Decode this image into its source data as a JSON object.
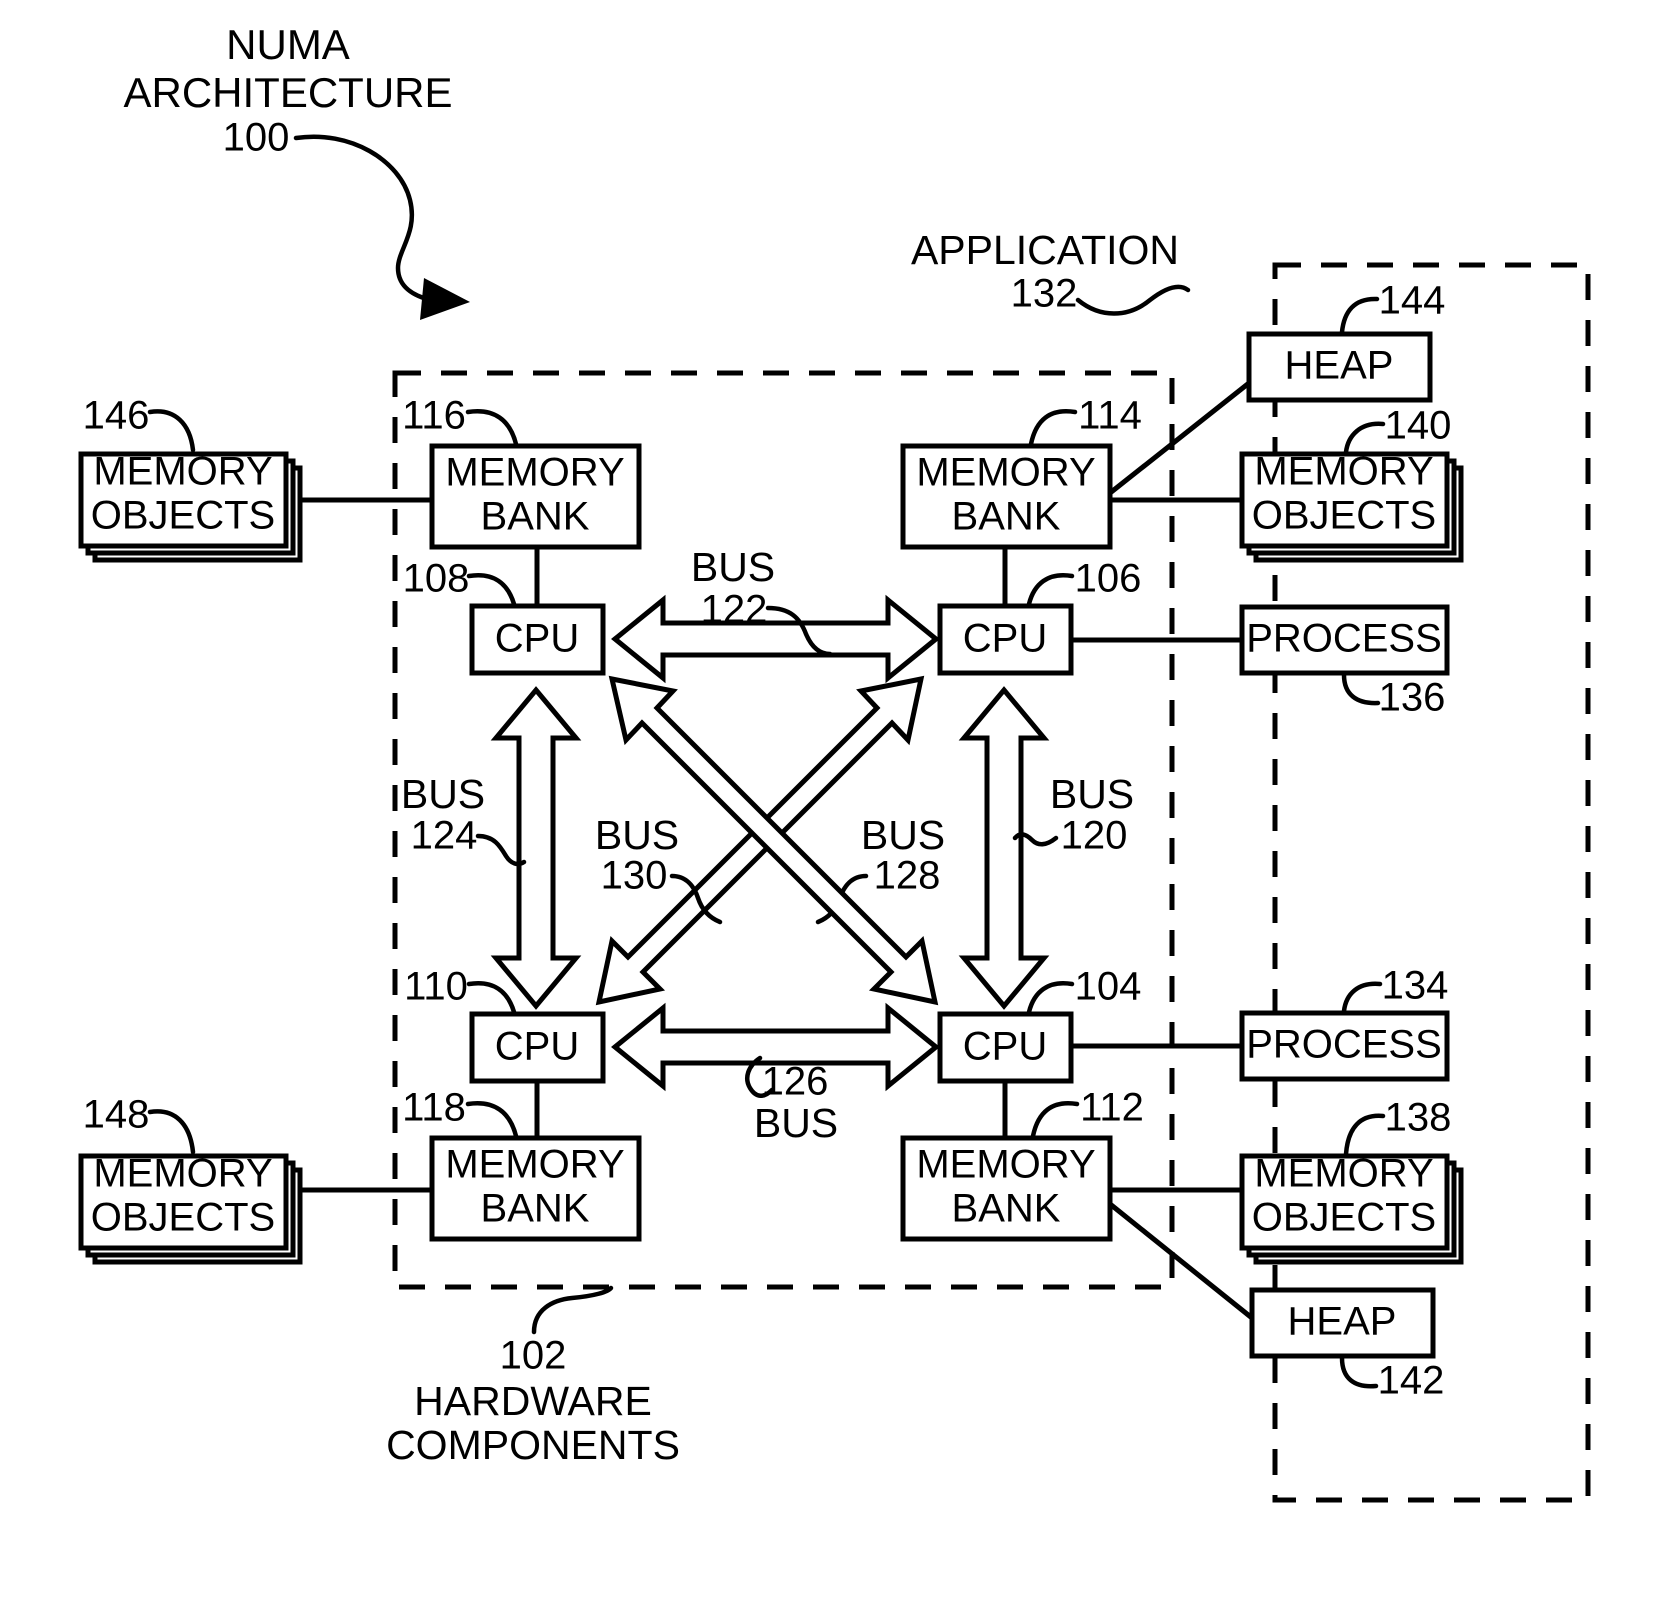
{
  "figure": {
    "title_lines": [
      "NUMA",
      "ARCHITECTURE"
    ],
    "title_ref": "100"
  },
  "regions": {
    "hardware": {
      "ref": "102",
      "label_lines": [
        "HARDWARE",
        "COMPONENTS"
      ],
      "style": "dashed-boundary"
    },
    "application": {
      "ref": "132",
      "label": "APPLICATION",
      "style": "dashed-boundary"
    }
  },
  "nodes": {
    "memory_bank_116": {
      "label_lines": [
        "MEMORY",
        "BANK"
      ],
      "ref": "116"
    },
    "memory_bank_114": {
      "label_lines": [
        "MEMORY",
        "BANK"
      ],
      "ref": "114"
    },
    "memory_bank_118": {
      "label_lines": [
        "MEMORY",
        "BANK"
      ],
      "ref": "118"
    },
    "memory_bank_112": {
      "label_lines": [
        "MEMORY",
        "BANK"
      ],
      "ref": "112"
    },
    "cpu_108": {
      "label": "CPU",
      "ref": "108"
    },
    "cpu_106": {
      "label": "CPU",
      "ref": "106"
    },
    "cpu_110": {
      "label": "CPU",
      "ref": "110"
    },
    "cpu_104": {
      "label": "CPU",
      "ref": "104"
    },
    "memory_objects_146": {
      "label_lines": [
        "MEMORY",
        "OBJECTS"
      ],
      "ref": "146",
      "stacked": true
    },
    "memory_objects_148": {
      "label_lines": [
        "MEMORY",
        "OBJECTS"
      ],
      "ref": "148",
      "stacked": true
    },
    "memory_objects_140": {
      "label_lines": [
        "MEMORY",
        "OBJECTS"
      ],
      "ref": "140",
      "stacked": true
    },
    "memory_objects_138": {
      "label_lines": [
        "MEMORY",
        "OBJECTS"
      ],
      "ref": "138",
      "stacked": true
    },
    "heap_144": {
      "label": "HEAP",
      "ref": "144"
    },
    "heap_142": {
      "label": "HEAP",
      "ref": "142"
    },
    "process_136": {
      "label": "PROCESS",
      "ref": "136"
    },
    "process_134": {
      "label": "PROCESS",
      "ref": "134"
    }
  },
  "buses": {
    "bus_122": {
      "label": "BUS",
      "ref": "122",
      "connects": [
        "cpu_108",
        "cpu_106"
      ],
      "direction": "bidirectional"
    },
    "bus_124": {
      "label": "BUS",
      "ref": "124",
      "connects": [
        "cpu_108",
        "cpu_110"
      ],
      "direction": "bidirectional"
    },
    "bus_120": {
      "label": "BUS",
      "ref": "120",
      "connects": [
        "cpu_106",
        "cpu_104"
      ],
      "direction": "bidirectional"
    },
    "bus_126": {
      "label": "BUS",
      "ref": "126",
      "connects": [
        "cpu_110",
        "cpu_104"
      ],
      "direction": "bidirectional"
    },
    "bus_128": {
      "label": "BUS",
      "ref": "128",
      "connects": [
        "cpu_106",
        "cpu_110"
      ],
      "direction": "bidirectional"
    },
    "bus_130": {
      "label": "BUS",
      "ref": "130",
      "connects": [
        "cpu_108",
        "cpu_104"
      ],
      "direction": "bidirectional"
    }
  }
}
